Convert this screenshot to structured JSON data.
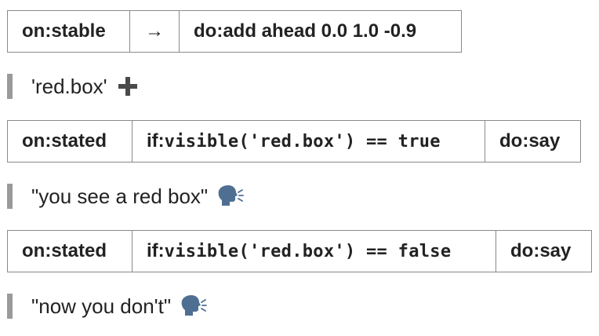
{
  "rules": [
    {
      "trigger": "on:stable",
      "arrow": "→",
      "action": "do:add ahead 0.0 1.0 -0.9"
    },
    {
      "trigger": "on:stated",
      "condition_prefix": "if:",
      "condition_code": "visible('red.box') == true",
      "action": "do:say"
    },
    {
      "trigger": "on:stated",
      "condition_prefix": "if:",
      "condition_code": "visible('red.box') == false",
      "action": "do:say"
    }
  ],
  "notes": [
    {
      "text": "'red.box'",
      "icon": "plus-icon"
    },
    {
      "text": "\"you see a red box\"",
      "icon": "speaking-head-icon"
    },
    {
      "text": "\"now you don't\"",
      "icon": "speaking-head-icon"
    }
  ],
  "colors": {
    "border": "#8a8a8a",
    "note_bar": "#9a9a9a",
    "text": "#222222",
    "speaking_head": "#4f6f92"
  }
}
